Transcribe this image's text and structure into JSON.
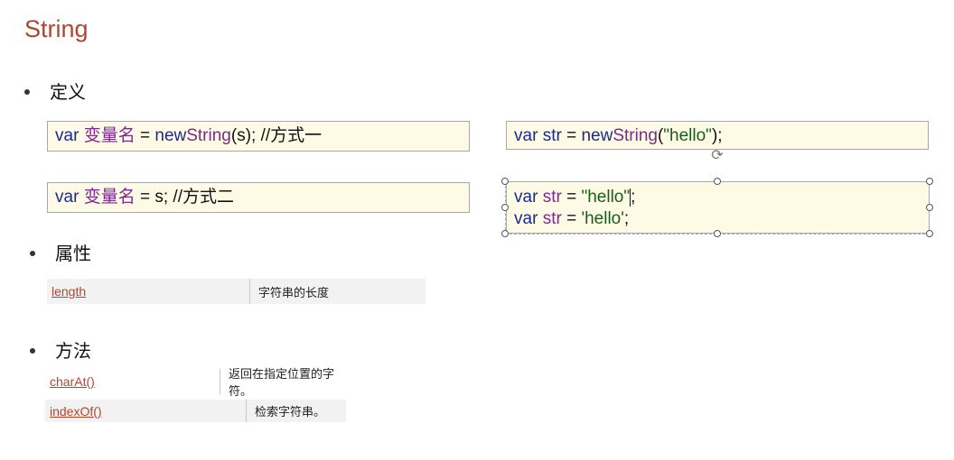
{
  "slide": {
    "title": "String"
  },
  "sections": {
    "definition": "定义",
    "properties": "属性",
    "methods": "方法"
  },
  "definition_boxes": {
    "way1": {
      "kw_var": "var",
      "name": "变量名",
      "op_eq": "=",
      "kw_new": "new",
      "cls": "String",
      "rest": "(s);",
      "comment": "//方式一"
    },
    "way2": {
      "kw_var": "var",
      "name": "变量名",
      "op_eq": "= s;",
      "comment": "//方式二"
    }
  },
  "example_boxes": {
    "example1": {
      "kw_var": "var",
      "ident": "str",
      "op_eq": "=",
      "kw_new": "new",
      "cls": "String",
      "paren_open": "(",
      "string": "\"hello\"",
      "paren_close": ");"
    },
    "example2": {
      "line1": {
        "kw_var": "var",
        "ident": "str",
        "op_eq": "=",
        "string": "\"hello\"",
        "semi": ";"
      },
      "line2": {
        "kw_var": "var",
        "ident": "str",
        "op_eq": "=",
        "string": "'hello'",
        "semi": ";"
      }
    }
  },
  "properties_table": [
    {
      "name": "length",
      "description": "字符串的长度"
    }
  ],
  "methods_table": [
    {
      "name": "charAt()",
      "description": "返回在指定位置的字符。"
    },
    {
      "name": "indexOf()",
      "description": "检索字符串。"
    }
  ],
  "icons": {
    "rotate": "rotate-handle-icon"
  },
  "colors": {
    "title": "#b3452c",
    "keyword": "#1c2a8c",
    "identifier": "#7a2a8c",
    "string": "#1a5c1a",
    "code_bg": "#fdfbe6",
    "link": "#b3452c"
  }
}
